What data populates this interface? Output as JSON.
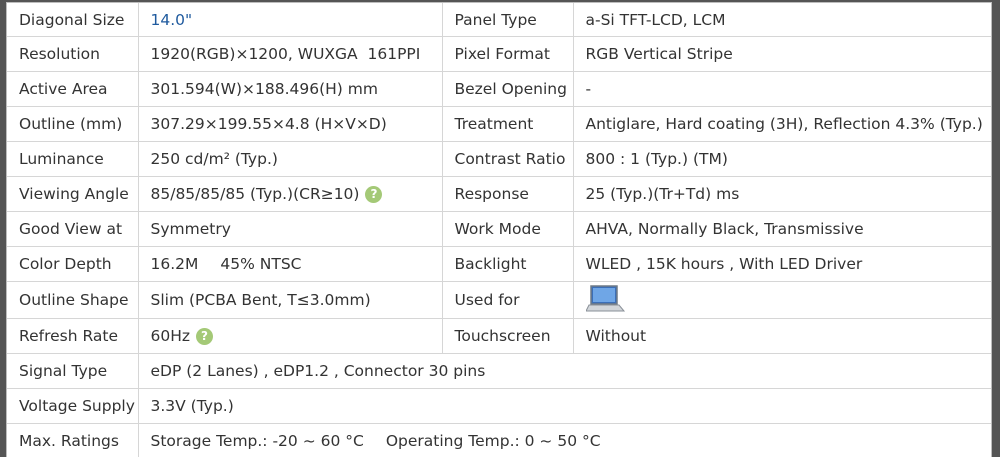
{
  "specs": [
    {
      "l1": "Diagonal Size",
      "v1": "14.0\"",
      "l2": "Panel Type",
      "v2": "a-Si TFT-LCD, LCM"
    },
    {
      "l1": "Resolution",
      "v1": "1920(RGB)×1200, WUXGA  161PPI",
      "l2": "Pixel Format",
      "v2": "RGB Vertical Stripe"
    },
    {
      "l1": "Active Area",
      "v1": "301.594(W)×188.496(H) mm",
      "l2": "Bezel Opening",
      "v2": "-"
    },
    {
      "l1": "Outline (mm)",
      "v1": "307.29×199.55×4.8 (H×V×D)",
      "l2": "Treatment",
      "v2": "Antiglare, Hard coating (3H), Reflection 4.3% (Typ.)"
    },
    {
      "l1": "Luminance",
      "v1": "250 cd/m² (Typ.)",
      "l2": "Contrast Ratio",
      "v2": "800 : 1 (Typ.) (TM)"
    },
    {
      "l1": "Viewing Angle",
      "v1": "85/85/85/85 (Typ.)(CR≥10)",
      "l2": "Response",
      "v2": "25 (Typ.)(Tr+Td) ms"
    },
    {
      "l1": "Good View at",
      "v1": "Symmetry",
      "l2": "Work Mode",
      "v2": "AHVA, Normally Black, Transmissive"
    },
    {
      "l1": "Color Depth",
      "v1": "16.2M",
      "v1b": "45% NTSC",
      "l2": "Backlight",
      "v2": "WLED , 15K hours , With LED Driver"
    },
    {
      "l1": "Outline Shape",
      "v1": "Slim (PCBA Bent, T≤3.0mm)",
      "l2": "Used for",
      "v2": ""
    },
    {
      "l1": "Refresh Rate",
      "v1": "60Hz",
      "l2": "Touchscreen",
      "v2": "Without"
    }
  ],
  "wide": [
    {
      "label": "Signal Type",
      "value": "eDP (2 Lanes) , eDP1.2 , Connector 30 pins"
    },
    {
      "label": "Voltage Supply",
      "value": "3.3V (Typ.)"
    },
    {
      "label": "Max. Ratings",
      "value": "Storage Temp.: -20 ~ 60 °C",
      "value2": "Operating Temp.: 0 ~ 50 °C"
    }
  ],
  "help_glyph": "?",
  "icons": {
    "help": "question-circle-icon",
    "used_for": "laptop-icon"
  }
}
